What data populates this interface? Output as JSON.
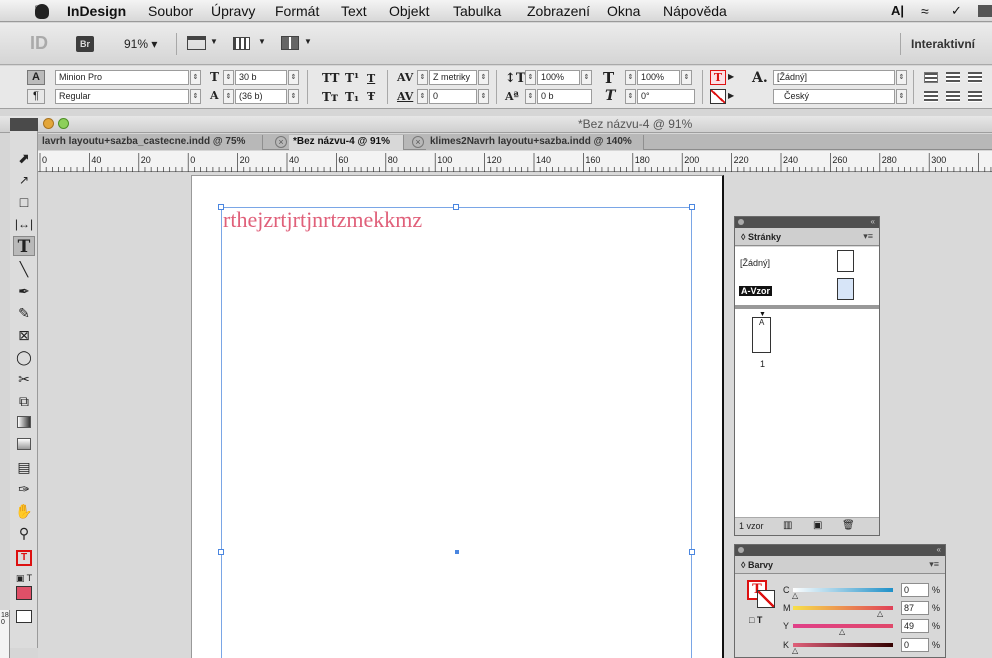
{
  "menubar": {
    "apple": "",
    "app_name": "InDesign",
    "items": [
      "Soubor",
      "Úpravy",
      "Formát",
      "Text",
      "Objekt",
      "Tabulka",
      "Zobrazení",
      "Okna",
      "Nápověda"
    ]
  },
  "app_toolbar": {
    "id_logo": "ID",
    "bridge": "Br",
    "zoom": "91% ▾",
    "workspace": "Interaktivní"
  },
  "control_panel": {
    "char_mode": "A",
    "para_mode": "¶",
    "font_family": "Minion Pro",
    "font_style": "Regular",
    "font_size": "30 b",
    "leading": "(36 b)",
    "tracking_mode": "Z metriky",
    "tracking": "0",
    "vscale": "100%",
    "hscale": "100%",
    "baseline": "0 b",
    "skew": "0°",
    "char_style": "[Žádný]",
    "language": "Český",
    "caps_glyphs": [
      "TT",
      "T¹",
      "T",
      "Tт",
      "T₁",
      "Ŧ"
    ]
  },
  "document": {
    "title": "*Bez názvu-4 @ 91%",
    "tabs": [
      {
        "label": "lavrh layoutu+sazba_castecne.indd @ 75%",
        "active": false
      },
      {
        "label": "*Bez názvu-4 @ 91%",
        "active": true
      },
      {
        "label": "klimes2Navrh layoutu+sazba.indd @ 140%",
        "active": false
      }
    ],
    "ruler_labels": [
      "0",
      "40",
      "20",
      "0",
      "20",
      "40",
      "60",
      "80",
      "100",
      "120",
      "140",
      "160",
      "180",
      "200",
      "220",
      "240",
      "260",
      "280",
      "300"
    ],
    "vruler_labels": "180",
    "body_text": "rthejzrtjrtjnrtzmekkmz",
    "text_color": "#e0607a"
  },
  "pages_panel": {
    "title": "◊ Stránky",
    "none_master": "[Žádný]",
    "a_master": "A-Vzor",
    "page_label": "A",
    "page_number": "1",
    "footer": "1 vzor"
  },
  "colors_panel": {
    "title": "◊ Barvy",
    "channels": [
      {
        "name": "C",
        "value": "0",
        "unit": "%"
      },
      {
        "name": "M",
        "value": "87",
        "unit": "%"
      },
      {
        "name": "Y",
        "value": "49",
        "unit": "%"
      },
      {
        "name": "K",
        "value": "0",
        "unit": "%"
      }
    ]
  }
}
